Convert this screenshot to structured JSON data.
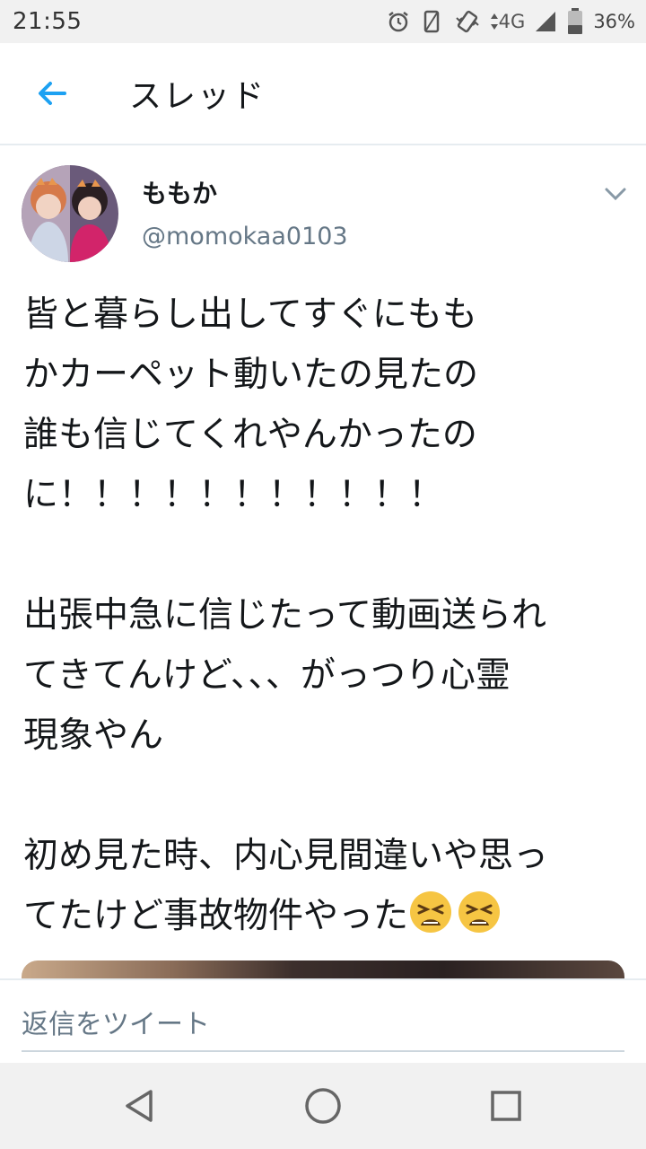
{
  "status_bar": {
    "time": "21:55",
    "network": "4G",
    "battery": "36%",
    "icons": [
      "alarm-icon",
      "vibrate-icon",
      "rotate-icon",
      "signal-icon",
      "battery-icon"
    ]
  },
  "header": {
    "title": "スレッド",
    "back_icon": "arrow-left-icon",
    "accent_color": "#1da1f2"
  },
  "tweet": {
    "display_name": "ももか",
    "handle": "@momokaa0103",
    "menu_icon": "chevron-down-icon",
    "text_para1": "皆と暮らし出してすぐにもも\nかカーペット動いたの見たの\n誰も信じてくれやんかったの\nに！！！！！！！！！！！",
    "text_para2": "出張中急に信じたって動画送られ\nてきてんけど、、、がっつり心霊\n現象やん",
    "text_para3": "初め見た時、内心見間違いや思っ\nてたけど事故物件やった",
    "trailing_emoji": [
      "tired-face-emoji",
      "tired-face-emoji"
    ]
  },
  "reply": {
    "placeholder": "返信をツイート"
  },
  "nav_bar": {
    "buttons": [
      "back-triangle-icon",
      "home-circle-icon",
      "recents-square-icon"
    ]
  }
}
